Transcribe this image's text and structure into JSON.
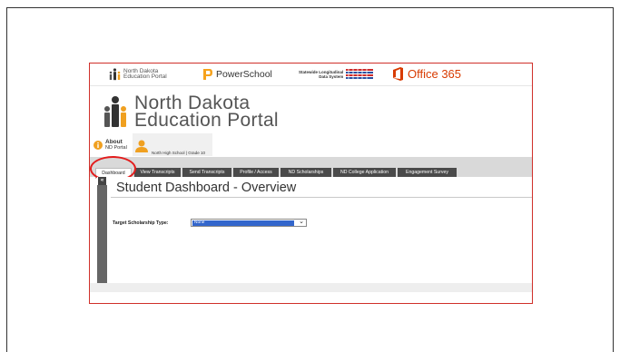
{
  "header_logos": {
    "nd_portal_small": "North Dakota\nEducation Portal",
    "powerschool": "PowerSchool",
    "slds": "Statewide Longitudinal\nData System",
    "office365": "Office 365"
  },
  "portal_title_line1": "North Dakota",
  "portal_title_line2": "Education Portal",
  "about": {
    "title": "About",
    "subtitle": "ND Portal"
  },
  "user": {
    "school_grade": "North High School | Grade 10"
  },
  "tabs": [
    {
      "label": "Dashboard",
      "active": true
    },
    {
      "label": "View Transcripts",
      "active": false
    },
    {
      "label": "Send Transcripts",
      "active": false
    },
    {
      "label": "Profile / Access",
      "active": false
    },
    {
      "label": "ND Scholarships",
      "active": false
    },
    {
      "label": "ND College Application",
      "active": false
    },
    {
      "label": "Engagement Survey",
      "active": false
    }
  ],
  "page": {
    "title": "Student Dashboard - Overview",
    "side_badge": "«",
    "scholarship_label": "Target Scholarship Type:",
    "scholarship_value": "None"
  },
  "colors": {
    "frame_border": "#d0302a",
    "tab_bg": "#4a4a4a",
    "select_highlight": "#3366cc",
    "office_orange": "#d83b01",
    "annotation_ring": "#e31c1c"
  }
}
